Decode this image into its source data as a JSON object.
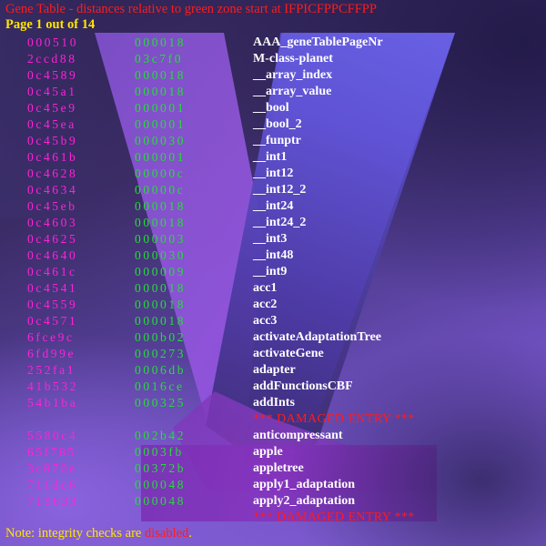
{
  "window": {
    "title": "Gene Table - distances relative to green zone start at IFPICFPPCFFPP",
    "title_color": "#ff1c1c",
    "page_indicator": "Page 1 out of 14",
    "page_indicator_color": "#ffe600"
  },
  "footer": {
    "prefix": "Note: integrity checks are ",
    "status": "disabled",
    "suffix": ".",
    "status_color": "#ff1c1c",
    "text_color": "#ffe600"
  },
  "colors": {
    "address": "#ff22d8",
    "distance": "#22e033",
    "name": "#ffffff",
    "damaged": "#ff1c1c",
    "background_dark": "#2a2050",
    "background_light": "#8663da",
    "chevron_violet": "#8a54d4",
    "chevron_blue": "#6155d6",
    "block_violet": "#8433bc"
  },
  "table": {
    "columns": [
      "address",
      "distance",
      "name"
    ],
    "rows": [
      {
        "address": "000510",
        "distance": "000018",
        "name": "AAA_geneTablePageNr",
        "damaged": false
      },
      {
        "address": "2ccd88",
        "distance": "03c7f0",
        "name": "M-class-planet",
        "damaged": false
      },
      {
        "address": "0c4589",
        "distance": "000018",
        "name": "__array_index",
        "damaged": false
      },
      {
        "address": "0c45a1",
        "distance": "000018",
        "name": "__array_value",
        "damaged": false
      },
      {
        "address": "0c45e9",
        "distance": "000001",
        "name": "__bool",
        "damaged": false
      },
      {
        "address": "0c45ea",
        "distance": "000001",
        "name": "__bool_2",
        "damaged": false
      },
      {
        "address": "0c45b9",
        "distance": "000030",
        "name": "__funptr",
        "damaged": false
      },
      {
        "address": "0c461b",
        "distance": "000001",
        "name": "__int1",
        "damaged": false
      },
      {
        "address": "0c4628",
        "distance": "00000c",
        "name": "__int12",
        "damaged": false
      },
      {
        "address": "0c4634",
        "distance": "00000c",
        "name": "__int12_2",
        "damaged": false
      },
      {
        "address": "0c45eb",
        "distance": "000018",
        "name": "__int24",
        "damaged": false
      },
      {
        "address": "0c4603",
        "distance": "000018",
        "name": "__int24_2",
        "damaged": false
      },
      {
        "address": "0c4625",
        "distance": "000003",
        "name": "__int3",
        "damaged": false
      },
      {
        "address": "0c4640",
        "distance": "000030",
        "name": "__int48",
        "damaged": false
      },
      {
        "address": "0c461c",
        "distance": "000009",
        "name": "__int9",
        "damaged": false
      },
      {
        "address": "0c4541",
        "distance": "000018",
        "name": "acc1",
        "damaged": false
      },
      {
        "address": "0c4559",
        "distance": "000018",
        "name": "acc2",
        "damaged": false
      },
      {
        "address": "0c4571",
        "distance": "000018",
        "name": "acc3",
        "damaged": false
      },
      {
        "address": "6fce9c",
        "distance": "000b02",
        "name": "activateAdaptationTree",
        "damaged": false
      },
      {
        "address": "6fd99e",
        "distance": "000273",
        "name": "activateGene",
        "damaged": false
      },
      {
        "address": "252fa1",
        "distance": "0006db",
        "name": "adapter",
        "damaged": false
      },
      {
        "address": "41b532",
        "distance": "0016ce",
        "name": "addFunctionsCBF",
        "damaged": false
      },
      {
        "address": "54b1ba",
        "distance": "000325",
        "name": "addInts",
        "damaged": false
      },
      {
        "address": "",
        "distance": "",
        "name": "*** DAMAGED ENTRY ***",
        "damaged": true
      },
      {
        "address": "5580c4",
        "distance": "002b42",
        "name": "anticompressant",
        "damaged": false
      },
      {
        "address": "65f785",
        "distance": "0003fb",
        "name": "apple",
        "damaged": false
      },
      {
        "address": "3c870e",
        "distance": "00372b",
        "name": "appletree",
        "damaged": false
      },
      {
        "address": "711dc6",
        "distance": "000048",
        "name": "apply1_adaptation",
        "damaged": false
      },
      {
        "address": "719633",
        "distance": "000048",
        "name": "apply2_adaptation",
        "damaged": false
      },
      {
        "address": "",
        "distance": "",
        "name": "*** DAMAGED ENTRY ***",
        "damaged": true
      }
    ]
  }
}
